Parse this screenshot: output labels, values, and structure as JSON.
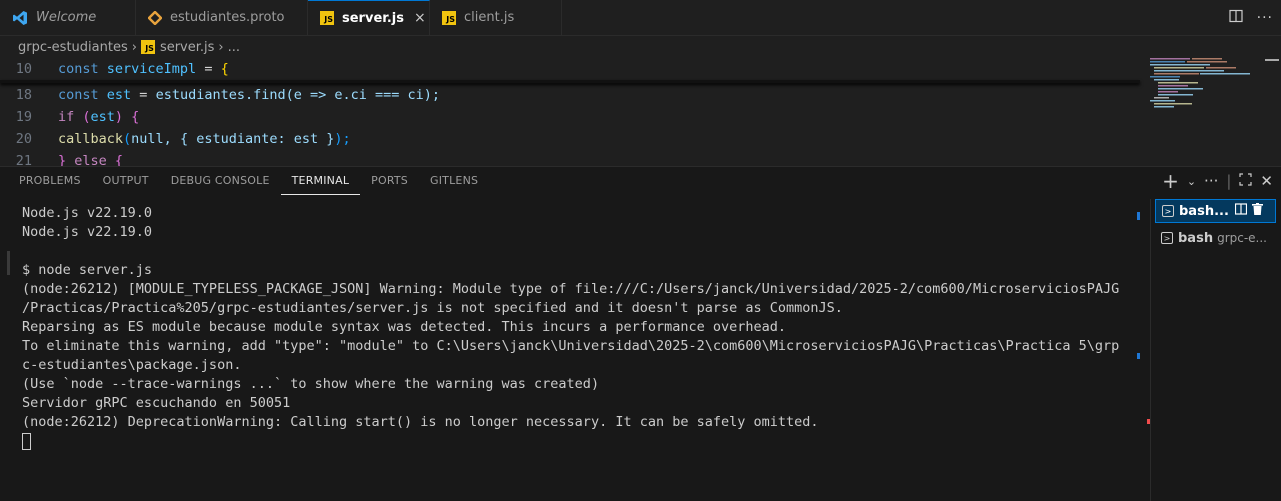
{
  "tabs": [
    {
      "label": "Welcome",
      "icon": "vscode-logo-icon"
    },
    {
      "label": "estudiantes.proto",
      "icon": "proto-file-icon"
    },
    {
      "label": "server.js",
      "icon": "js-file-icon",
      "active": true
    },
    {
      "label": "client.js",
      "icon": "js-file-icon"
    }
  ],
  "tab_close": "×",
  "js_badge": "JS",
  "breadcrumb": {
    "folder": "grpc-estudiantes",
    "file": "server.js",
    "more": "..."
  },
  "editor": {
    "lines": [
      {
        "num": "10",
        "p1": "const ",
        "p2": "serviceImpl",
        "p3": " = ",
        "p4": "{"
      },
      {
        "num": "18",
        "p1": "const ",
        "p2": "est",
        "p3": " = ",
        "p4": "estudiantes.find(e => e.ci === ci);"
      },
      {
        "num": "19",
        "p1": "if ",
        "p2": "(",
        "p3": "est",
        "p4": ") {"
      },
      {
        "num": "20",
        "p1": "callback",
        "p2": "(",
        "p3": "null, { estudiante: est }",
        "p4": ");"
      },
      {
        "num": "21",
        "p1": "} ",
        "p2": "else ",
        "p3": "{",
        "p4": ""
      }
    ]
  },
  "panel": {
    "tabs": [
      "PROBLEMS",
      "OUTPUT",
      "DEBUG CONSOLE",
      "TERMINAL",
      "PORTS",
      "GITLENS"
    ],
    "active_tab": "TERMINAL"
  },
  "terminal": {
    "lines": [
      "Node.js v22.19.0",
      "Node.js v22.19.0",
      "",
      "$ node server.js",
      "(node:26212) [MODULE_TYPELESS_PACKAGE_JSON] Warning: Module type of file:///C:/Users/janck/Universidad/2025-2/com600/MicroserviciosPAJG",
      "/Practicas/Practica%205/grpc-estudiantes/server.js is not specified and it doesn't parse as CommonJS.",
      "Reparsing as ES module because module syntax was detected. This incurs a performance overhead.",
      "To eliminate this warning, add \"type\": \"module\" to C:\\Users\\janck\\Universidad\\2025-2\\com600\\MicroserviciosPAJG\\Practicas\\Practica 5\\grp",
      "c-estudiantes\\package.json.",
      "(Use `node --trace-warnings ...` to show where the warning was created)",
      "Servidor gRPC escuchando en 50051",
      "(node:26212) DeprecationWarning: Calling start() is no longer necessary. It can be safely omitted."
    ]
  },
  "terminal_list": [
    {
      "label": "bash...",
      "desc": "",
      "active": true
    },
    {
      "label": "bash",
      "desc": "grpc-e...",
      "active": false
    }
  ],
  "colors": {
    "accent": "#0078d4",
    "js_badge": "#f1c40f"
  }
}
